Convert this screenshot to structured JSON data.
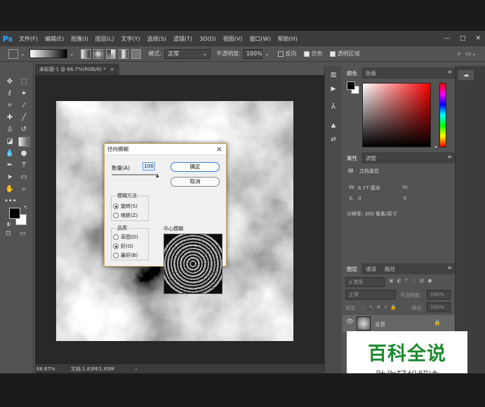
{
  "menu": [
    "文件(F)",
    "编辑(E)",
    "图像(I)",
    "图层(L)",
    "文字(Y)",
    "选择(S)",
    "滤镜(T)",
    "3D(D)",
    "视图(V)",
    "窗口(W)",
    "帮助(H)"
  ],
  "app_logo": "Ps",
  "window_controls": {
    "minimize": "—",
    "restore": "□",
    "close": "✕"
  },
  "options": {
    "mode_label": "模式:",
    "mode_value": "正常",
    "opacity_label": "不透明度:",
    "opacity_value": "100%",
    "reverse_label": "反向",
    "dither_label": "仿色",
    "transparency_label": "透明区域"
  },
  "document": {
    "tab_title": "未标题-1 @ 66.7%(RGB/8) *",
    "tab_close": "×",
    "zoom": "66.67%",
    "doc_info": "文档:1.83M/1.83M",
    "arrow": "›"
  },
  "dialog": {
    "title": "径向模糊",
    "amount_label": "数量(A)",
    "amount_value": "100",
    "ok_label": "确定",
    "cancel_label": "取消",
    "method_group": "模糊方法:",
    "method_spin": "旋转(S)",
    "method_zoom": "缩放(Z)",
    "quality_group": "品质:",
    "quality_draft": "草图(D)",
    "quality_good": "好(G)",
    "quality_best": "最好(B)",
    "center_label": "中心模糊",
    "slider_level": 1.0
  },
  "panels": {
    "color_tab": "颜色",
    "swatches_tab": "色板",
    "properties_tab": "属性",
    "adjustments_tab": "调整",
    "doc_properties": "文档属性",
    "w_label": "W:",
    "w_value": "6.77 厘米",
    "h_label": "H:",
    "x_label": "X:",
    "x_value": "0",
    "y_label": "Y:",
    "resolution": "分辨率: 300 像素/英寸",
    "layers_tab": "图层",
    "channels_tab": "通道",
    "paths_tab": "路径",
    "kind_filter": "ρ 类型",
    "blend_mode": "正常",
    "opacity_label": "不透明度:",
    "opacity_value": "100%",
    "lock_label": "锁定:",
    "fill_label": "填充:",
    "fill_value": "100%",
    "layer_name": "背景"
  },
  "watermark": {
    "title": "百科全说",
    "subtitle": "助你轻松解决"
  },
  "colors": {
    "app_bg": "#535353",
    "menubar": "#3c3c3c",
    "accent": "#31a8ff",
    "watermark_green": "#1d8a2f"
  }
}
